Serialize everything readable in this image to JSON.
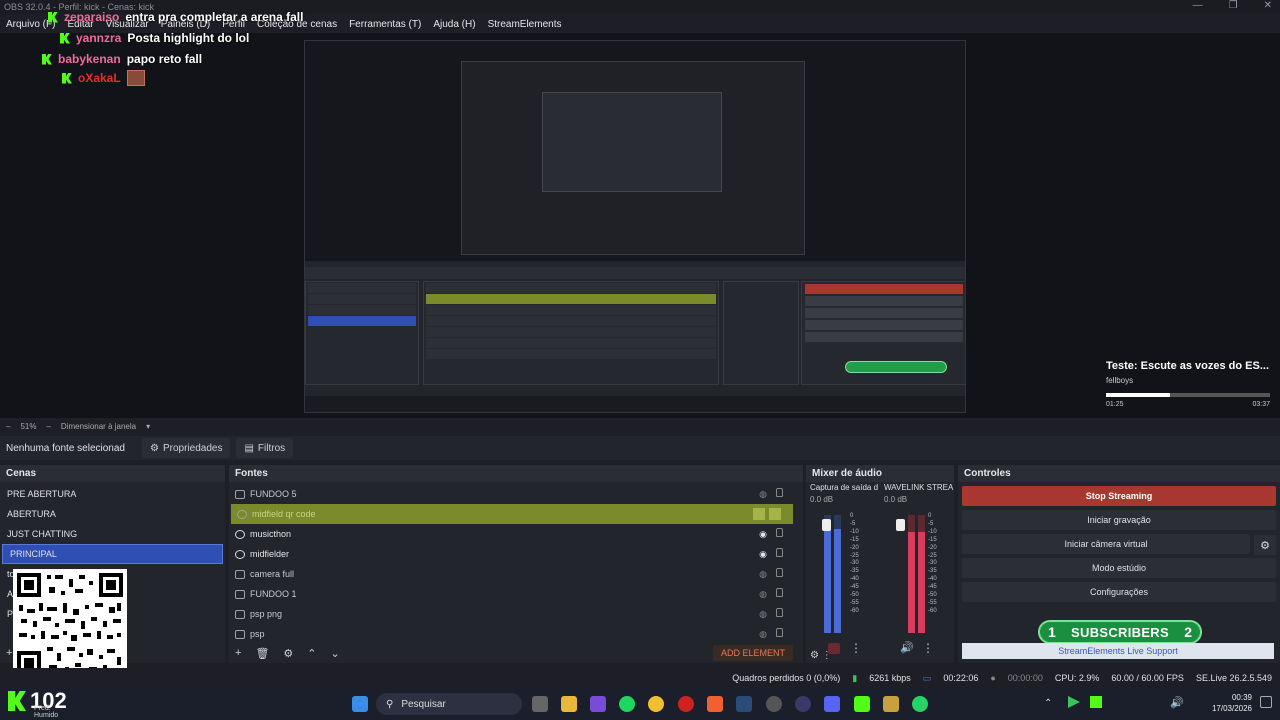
{
  "window": {
    "title": "OBS 32.0.4 - Perfil: kick - Cenas: kick"
  },
  "menu": [
    "Arquivo (F)",
    "Editar",
    "Visualizar",
    "Painéis (D)",
    "Perfil",
    "Coleção de cenas",
    "Ferramentas (T)",
    "Ajuda (H)",
    "StreamElements"
  ],
  "chat": [
    {
      "user": "zeparaiso",
      "message": "entra pra completar a arena fall"
    },
    {
      "user": "yannzra",
      "message": "Posta highlight do lol"
    },
    {
      "user": "babykenan",
      "message": "papo reto fall"
    },
    {
      "user": "oXakaL",
      "message": ""
    }
  ],
  "now_playing": {
    "title": "Teste: Escute as vozes do ES...",
    "artist": "fellboys",
    "elapsed": "01:25",
    "total": "03:37",
    "progress": 0.39
  },
  "zoom": {
    "level": "51%",
    "mode": "Dimensionar à janela"
  },
  "source_toolbar": {
    "no_source": "Nenhuma fonte selecionad",
    "properties": "Propriedades",
    "filters": "Filtros"
  },
  "scenes": {
    "title": "Cenas",
    "items": [
      "PRE ABERTURA",
      "ABERTURA",
      "JUST CHATTING",
      "PRINCIPAL",
      "to",
      "AI",
      "P"
    ],
    "selected": "PRINCIPAL"
  },
  "sources": {
    "title": "Fontes",
    "items": [
      {
        "name": "FUNDOO 5",
        "visible": false
      },
      {
        "name": "midfield qr code",
        "visible": false,
        "highlighted": true
      },
      {
        "name": "musicthon",
        "visible": true
      },
      {
        "name": "midfielder",
        "visible": true
      },
      {
        "name": "camera full",
        "visible": false
      },
      {
        "name": "FUNDOO 1",
        "visible": false
      },
      {
        "name": "psp png",
        "visible": false
      },
      {
        "name": "psp",
        "visible": false
      }
    ],
    "add_element": "ADD ELEMENT"
  },
  "mixer": {
    "title": "Mixer de áudio",
    "channels": [
      {
        "name": "Captura de saída d",
        "db": "0.0 dB",
        "level": 0.88,
        "color": "blue"
      },
      {
        "name": "WAVELINK STREAM",
        "db": "0.0 dB",
        "level": 0.86,
        "color": "red"
      }
    ],
    "scale": [
      "0",
      "-5",
      "-10",
      "-15",
      "-20",
      "-25",
      "-30",
      "-35",
      "-40",
      "-45",
      "-50",
      "-55",
      "-60"
    ]
  },
  "controls": {
    "title": "Controles",
    "stop_streaming": "Stop Streaming",
    "start_recording": "Iniciar gravação",
    "virtual_camera": "Iniciar câmera virtual",
    "studio_mode": "Modo estúdio",
    "settings": "Configurações",
    "subs_left": "1",
    "subs_label": "SUBSCRIBERS",
    "subs_right": "2",
    "support": "StreamElements Live Support"
  },
  "status": {
    "dropped": "Quadros perdidos 0 (0,0%)",
    "bitrate": "6261 kbps",
    "stream_time": "00:22:06",
    "rec_time": "00:00:00",
    "cpu": "CPU: 2.9%",
    "fps": "60.00 / 60.00 FPS",
    "version": "SE.Live 26.2.5.549"
  },
  "taskbar": {
    "search": "Pesquisar",
    "time": "00:39",
    "date": "17/03/2026"
  },
  "overlay": {
    "kick_count": "102",
    "kick_sub": "Pred. Humido"
  },
  "colors": {
    "accent_blue": "#2f4fb5",
    "stop_red": "#a8382f",
    "kick_green": "#53fc18",
    "subs_green": "#1a8f3f"
  }
}
